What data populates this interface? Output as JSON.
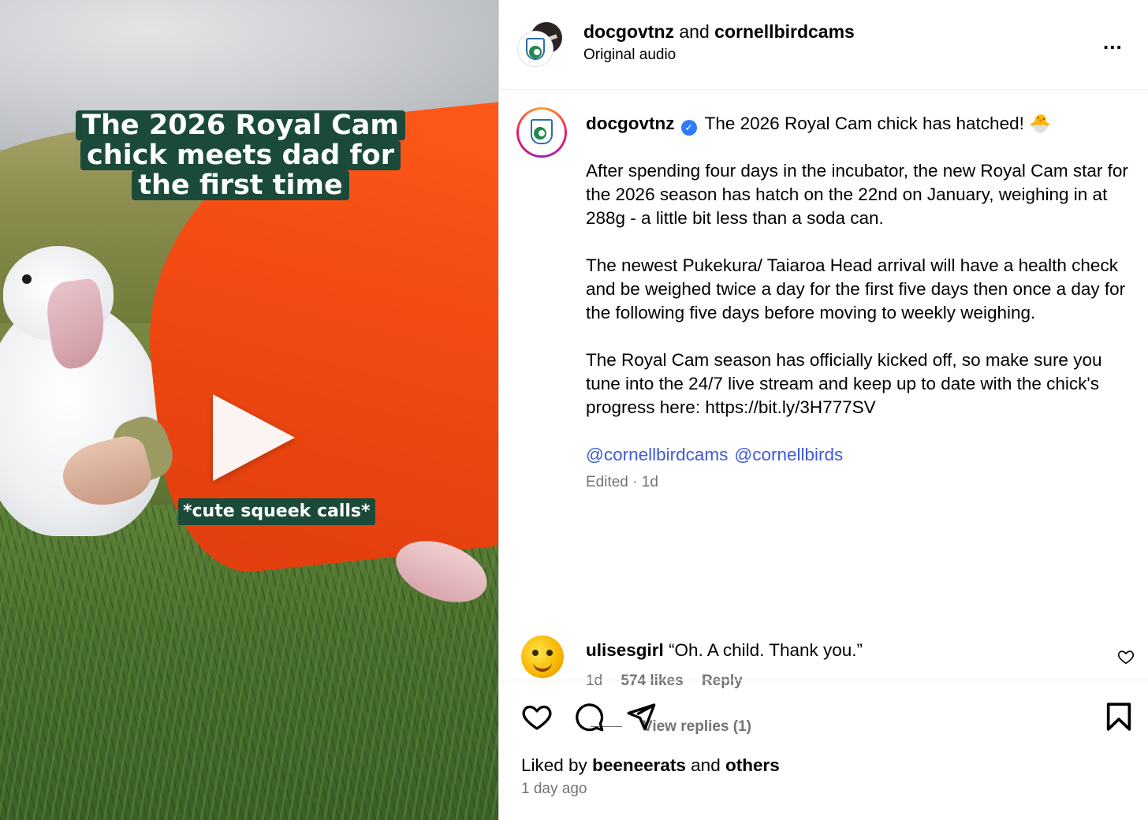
{
  "media": {
    "overlay_title_lines": [
      "The 2026 Royal Cam",
      "chick meets dad for",
      "the first time"
    ],
    "subtitle": "*cute squeek calls*"
  },
  "header": {
    "user1": "docgovtnz",
    "joiner": "and",
    "user2": "cornellbirdcams",
    "audio": "Original audio",
    "more": "..."
  },
  "caption": {
    "username": "docgovtnz",
    "verified_mark": "✓",
    "headline": "The 2026 Royal Cam chick has hatched! 🐣",
    "paragraphs": [
      "After spending four days in the incubator, the new Royal Cam star for the 2026 season has hatch on the 22nd on January, weighing in at 288g - a little bit less than a soda can.",
      "The newest Pukekura/ Taiaroa Head arrival will have a health check and be weighed twice a day for the first five days then once a day for the following five days before moving to weekly weighing.",
      "The Royal Cam season has officially kicked off, so make sure you tune into the 24/7 live stream and keep up to date with the chick's progress here: https://bit.ly/3H777SV"
    ],
    "mentions": [
      "@cornellbirdcams",
      "@cornellbirds"
    ],
    "edited": "Edited · 1d"
  },
  "comment": {
    "username": "ulisesgirl",
    "text": "“Oh. A child. Thank you.”",
    "age": "1d",
    "likes": "574 likes",
    "reply": "Reply",
    "view_replies": "View replies (1)"
  },
  "footer": {
    "liked_by_prefix": "Liked by",
    "liked_by_user": "beeneerats",
    "liked_and": "and",
    "liked_others": "others",
    "time": "1 day ago"
  },
  "icons": [
    "heart-icon",
    "comment-icon",
    "share-icon",
    "bookmark-icon",
    "more-icon",
    "play-icon",
    "verified-icon"
  ],
  "colors": {
    "link": "#3f5bd6",
    "verified": "#2f7cf6",
    "secondary_text": "#737373",
    "overlay_box": "#1b4a3a"
  }
}
